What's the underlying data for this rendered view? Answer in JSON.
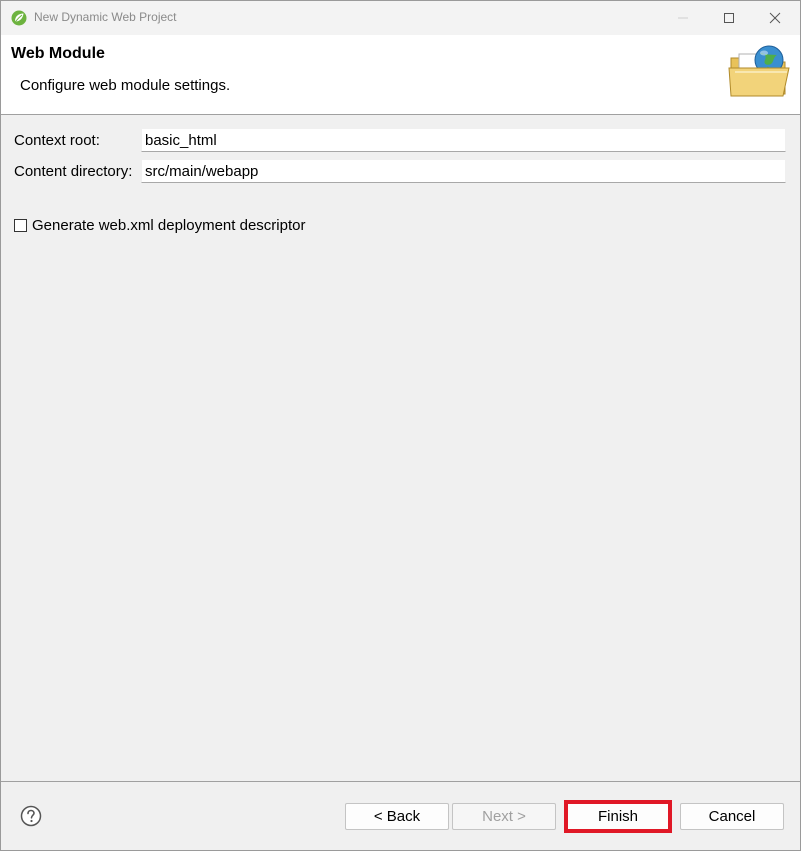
{
  "window": {
    "title": "New Dynamic Web Project"
  },
  "header": {
    "title": "Web Module",
    "description": "Configure web module settings."
  },
  "form": {
    "context_root_label": "Context root:",
    "context_root_value": "basic_html",
    "content_directory_label": "Content directory:",
    "content_directory_value": "src/main/webapp",
    "generate_webxml_label": "Generate web.xml deployment descriptor",
    "generate_webxml_checked": false
  },
  "buttons": {
    "back": "< Back",
    "next": "Next >",
    "finish": "Finish",
    "cancel": "Cancel"
  },
  "icons": {
    "app": "spring-leaf-icon",
    "help": "help-icon",
    "banner": "web-folder-globe-icon"
  },
  "colors": {
    "highlight": "#e01826",
    "dialog_background": "#f0f0f0",
    "header_background": "#ffffff"
  }
}
